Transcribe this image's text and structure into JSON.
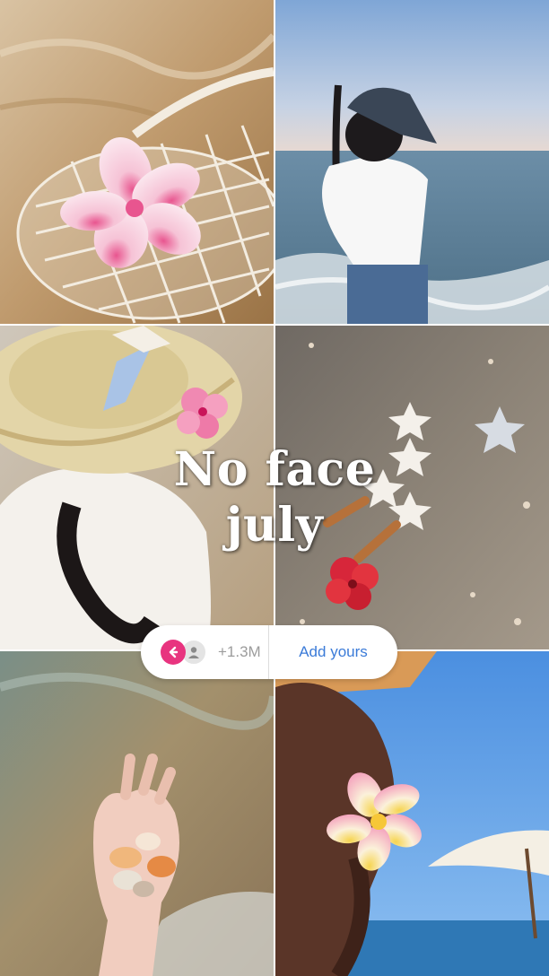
{
  "overlay": {
    "title_line1": "No face",
    "title_line2": "july"
  },
  "add_yours_sticker": {
    "count": "+1.3M",
    "button_label": "Add yours",
    "arrow_icon": "reply-arrow-icon",
    "avatar_icon": "person-avatar-icon",
    "accent_color": "#e8347f",
    "link_color": "#3b7bd8"
  },
  "tiles": [
    {
      "subject": "straw-bag-with-plumeria-on-sand"
    },
    {
      "subject": "girl-in-cap-at-seashore"
    },
    {
      "subject": "straw-hat-selfie-with-hibiscus"
    },
    {
      "subject": "starfish-and-shells-on-sand"
    },
    {
      "subject": "hand-holding-seashells"
    },
    {
      "subject": "hair-clip-plumeria-beach-umbrella"
    }
  ]
}
